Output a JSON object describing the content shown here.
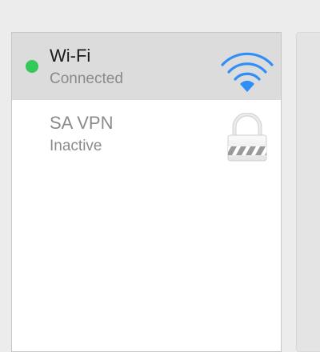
{
  "services": [
    {
      "name": "Wi-Fi",
      "status": "Connected",
      "status_color": "#34c759",
      "icon": "wifi-icon",
      "selected": true
    },
    {
      "name": "SA VPN",
      "status": "Inactive",
      "icon": "vpn-lock-icon",
      "selected": false
    }
  ],
  "colors": {
    "wifi_blue": "#2f8ef7",
    "selected_row": "#dcdcdc"
  }
}
